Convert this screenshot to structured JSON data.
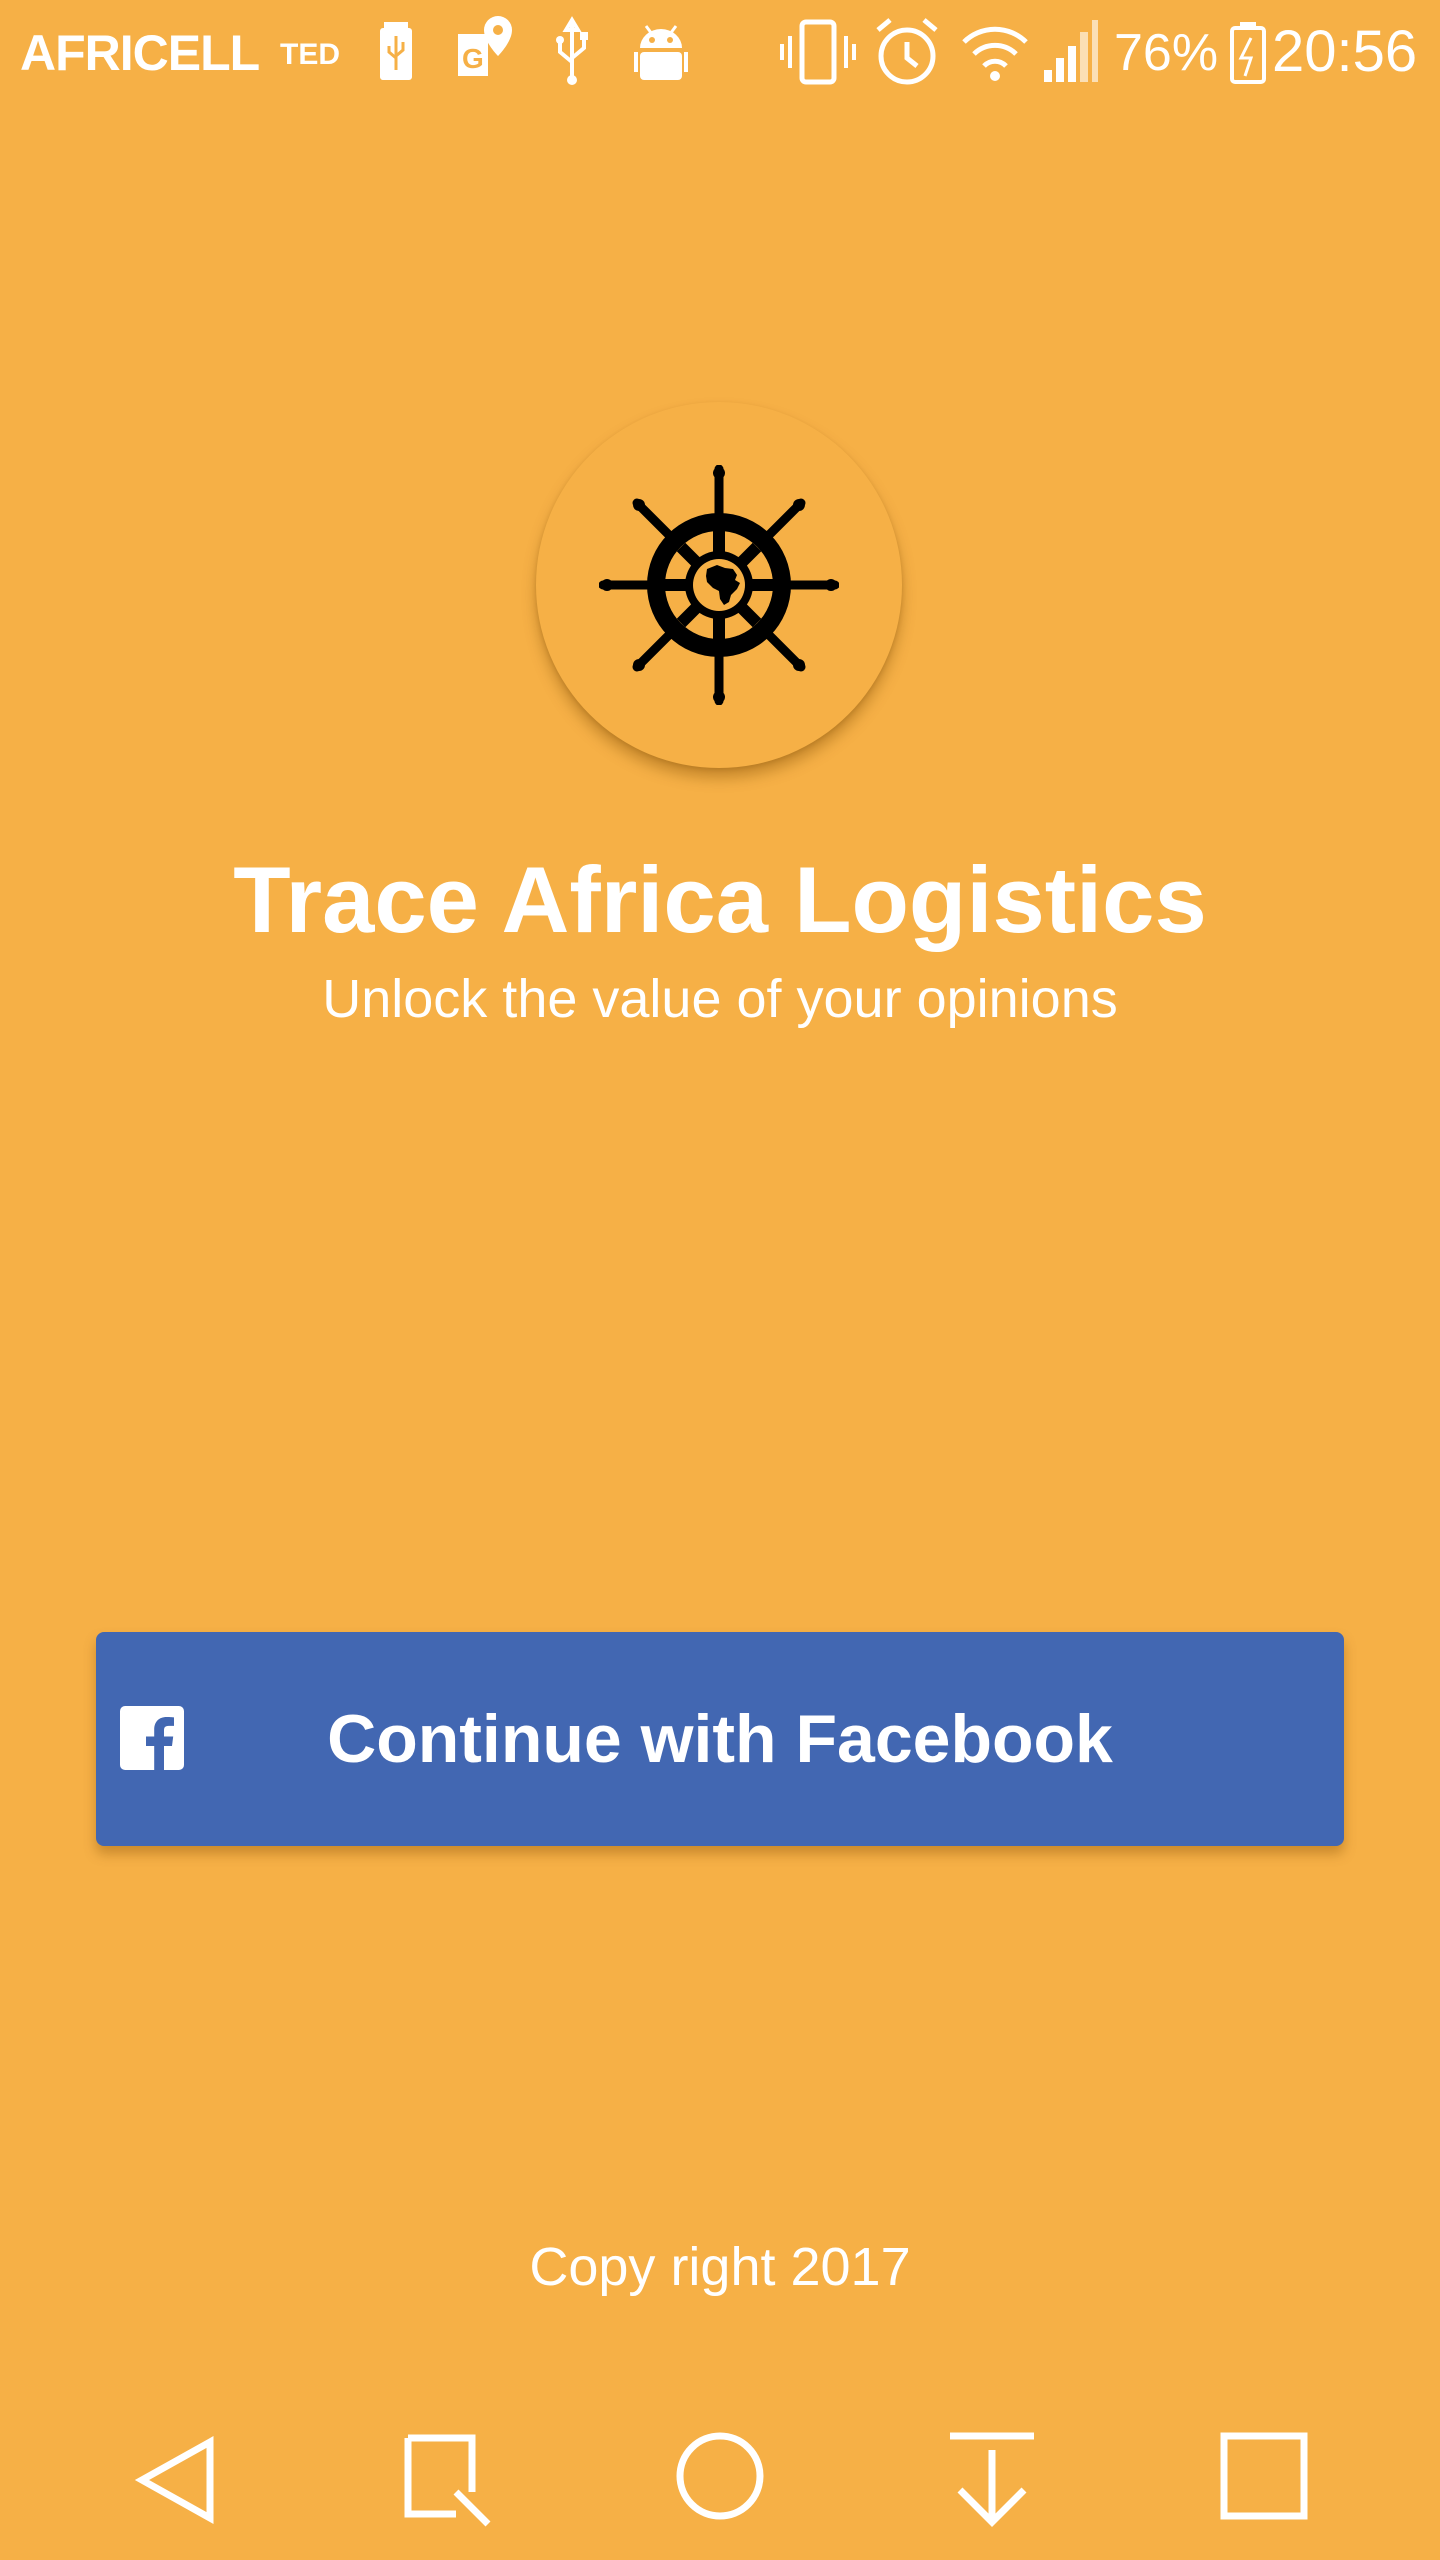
{
  "status_bar": {
    "carrier": "AFRICELL",
    "carrier_secondary": "TED",
    "battery_percent": "76%",
    "time": "20:56",
    "icons": [
      "battery-usb-icon",
      "maps-icon",
      "usb-icon",
      "android-icon",
      "vibrate-icon",
      "alarm-icon",
      "wifi-icon",
      "signal-icon",
      "charging-battery-icon"
    ]
  },
  "app": {
    "logo_icon": "ship-wheel-africa-icon",
    "title": "Trace Africa Logistics",
    "subtitle": "Unlock the value of your opinions"
  },
  "facebook_button": {
    "label": "Continue with Facebook",
    "icon": "facebook-icon",
    "color": "#4267B2"
  },
  "footer": {
    "copyright": "Copy right 2017"
  },
  "nav_bar": {
    "buttons": [
      "back-icon",
      "capture-icon",
      "home-icon",
      "notification-pull-icon",
      "recents-icon"
    ]
  },
  "theme": {
    "background": "#F6B046",
    "text": "#FFFFFF"
  }
}
